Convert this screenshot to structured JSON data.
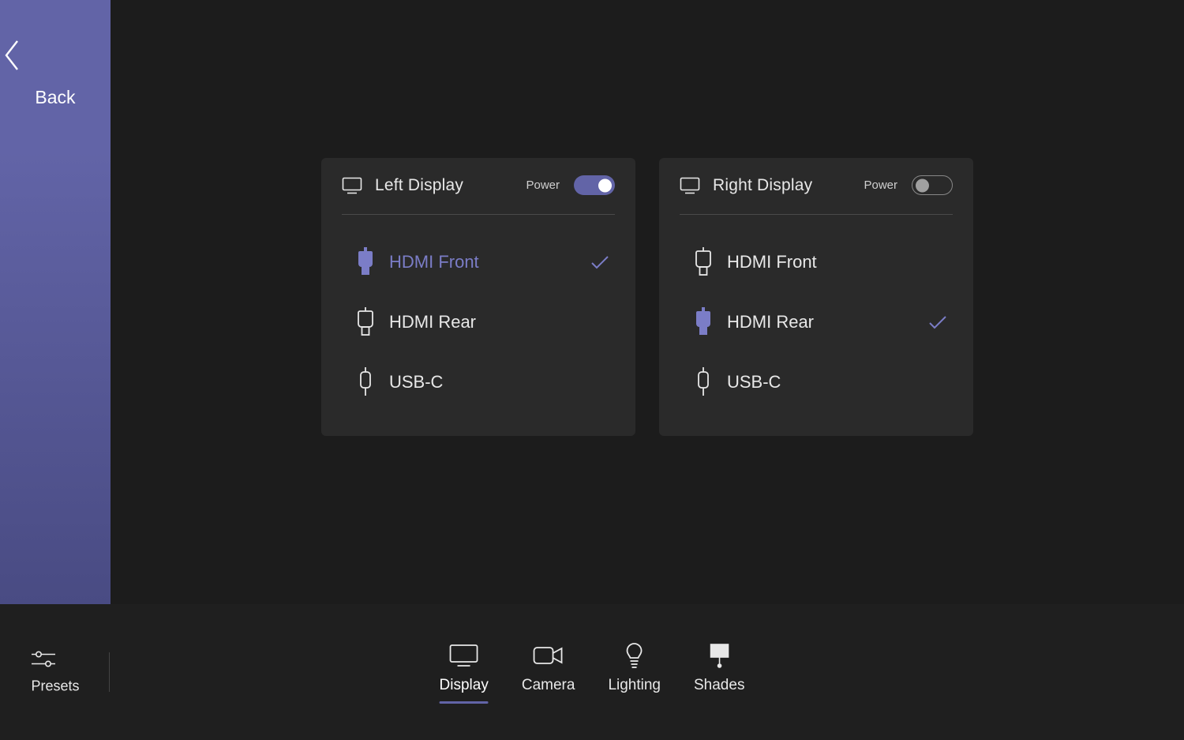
{
  "sidebar": {
    "back_label": "Back"
  },
  "cards": [
    {
      "title": "Left Display",
      "power_label": "Power",
      "power_on": true,
      "sources": [
        {
          "label": "HDMI Front",
          "selected": true,
          "type": "hdmi"
        },
        {
          "label": "HDMI Rear",
          "selected": false,
          "type": "hdmi"
        },
        {
          "label": "USB-C",
          "selected": false,
          "type": "usbc"
        }
      ]
    },
    {
      "title": "Right Display",
      "power_label": "Power",
      "power_on": false,
      "sources": [
        {
          "label": "HDMI Front",
          "selected": false,
          "type": "hdmi"
        },
        {
          "label": "HDMI Rear",
          "selected": true,
          "type": "hdmi"
        },
        {
          "label": "USB-C",
          "selected": false,
          "type": "usbc"
        }
      ]
    }
  ],
  "bottombar": {
    "presets_label": "Presets",
    "nav": [
      {
        "label": "Display",
        "icon": "display",
        "active": true
      },
      {
        "label": "Camera",
        "icon": "camera",
        "active": false
      },
      {
        "label": "Lighting",
        "icon": "lighting",
        "active": false
      },
      {
        "label": "Shades",
        "icon": "shades",
        "active": false
      }
    ]
  },
  "colors": {
    "accent": "#6264a7"
  }
}
